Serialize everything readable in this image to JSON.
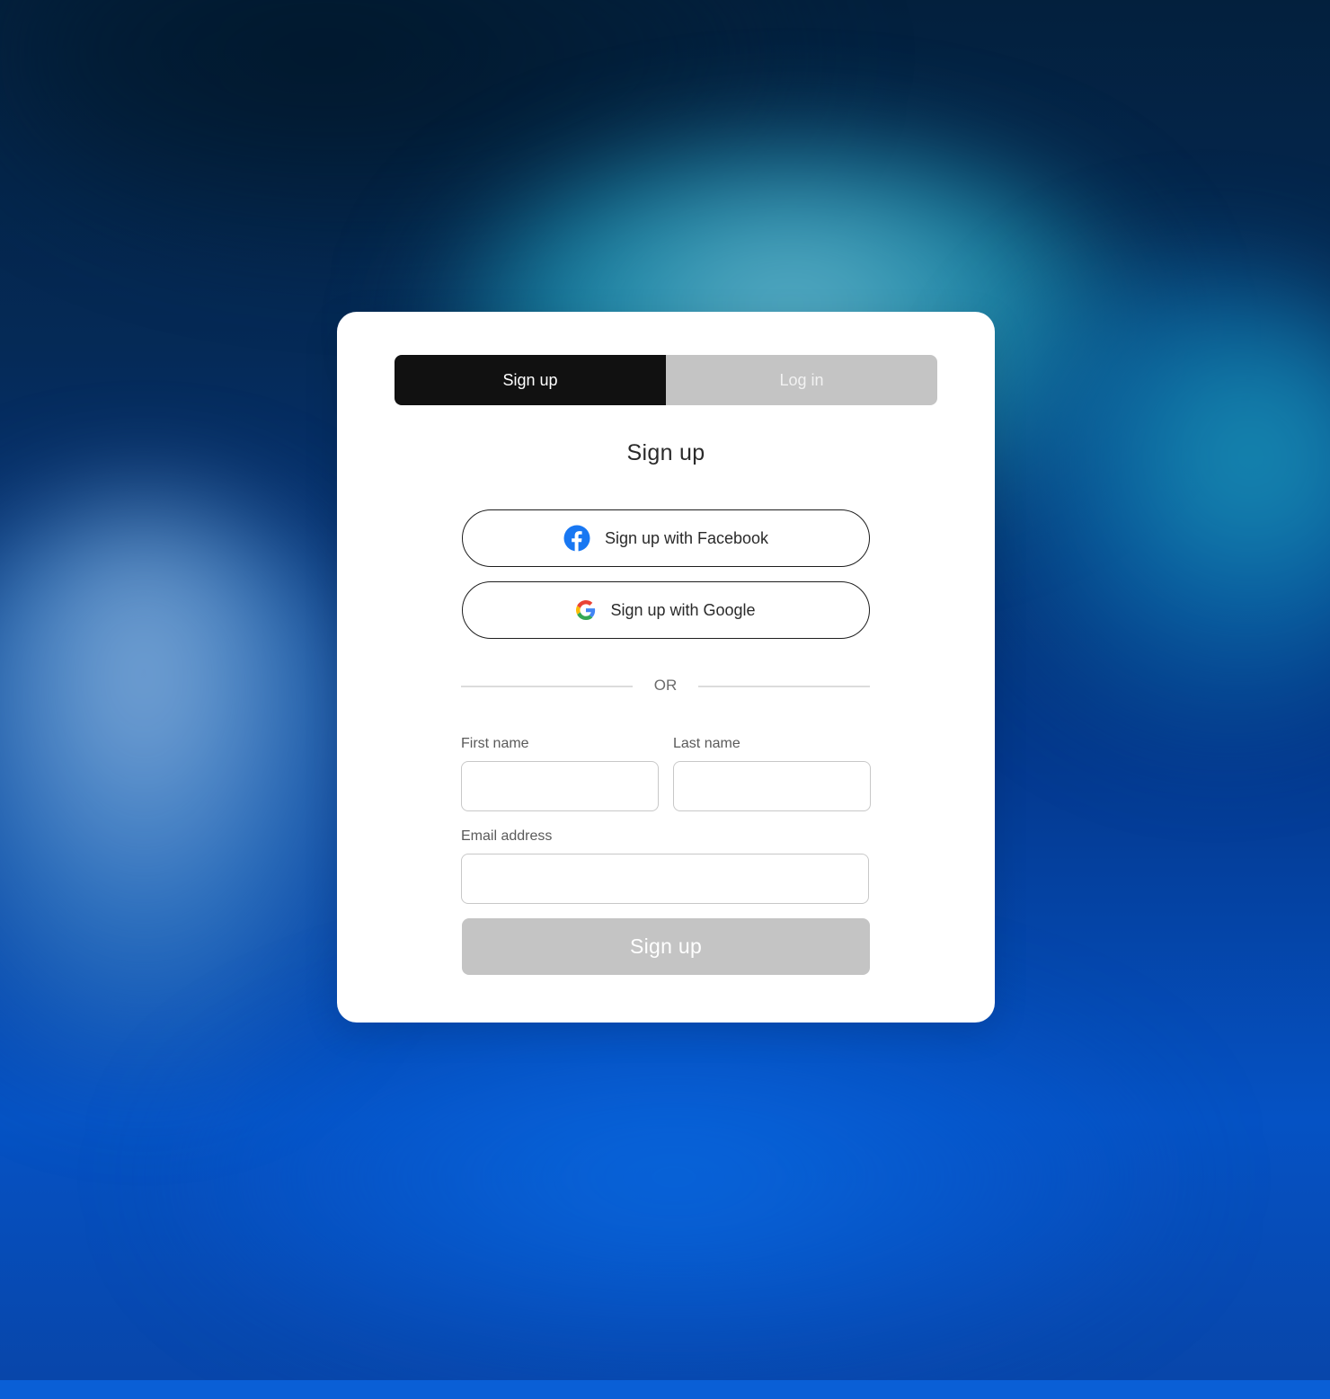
{
  "tabs": {
    "signup_label": "Sign up",
    "login_label": "Log in",
    "active": "signup"
  },
  "form": {
    "title": "Sign up",
    "facebook_label": "Sign up with Facebook",
    "google_label": "Sign up with Google",
    "divider_text": "OR",
    "first_name": {
      "label": "First name",
      "value": "",
      "placeholder": ""
    },
    "last_name": {
      "label": "Last name",
      "value": "",
      "placeholder": ""
    },
    "email": {
      "label": "Email address",
      "value": "",
      "placeholder": ""
    },
    "submit_label": "Sign up",
    "submit_enabled": false
  },
  "colors": {
    "active_tab_bg": "#111111",
    "inactive_tab_bg": "#c4c4c4",
    "disabled_button_bg": "#c4c4c4",
    "facebook_blue": "#1877f2",
    "background_dark": "#03203d",
    "background_blue": "#0552c4"
  },
  "icons": {
    "facebook": "facebook-icon",
    "google": "google-icon"
  }
}
